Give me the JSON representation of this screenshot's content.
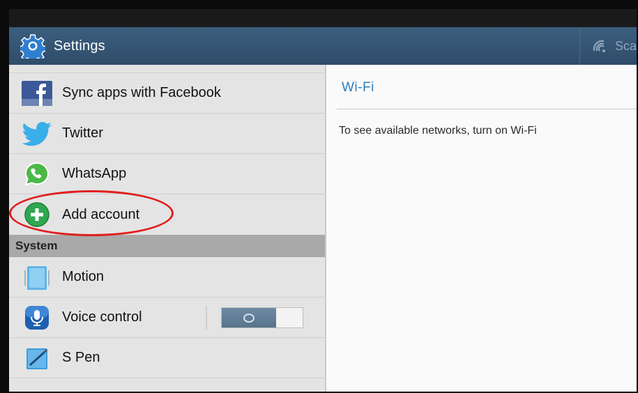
{
  "actionbar": {
    "title": "Settings",
    "scan_label": "Sca"
  },
  "accounts": [
    {
      "label": "Sync apps with Facebook",
      "icon": "facebook-icon"
    },
    {
      "label": "Twitter",
      "icon": "twitter-icon"
    },
    {
      "label": "WhatsApp",
      "icon": "whatsapp-icon"
    },
    {
      "label": "Add account",
      "icon": "add-icon"
    }
  ],
  "system": {
    "header": "System",
    "items": [
      {
        "label": "Motion",
        "icon": "motion-icon"
      },
      {
        "label": "Voice control",
        "icon": "microphone-icon",
        "toggle": "off"
      },
      {
        "label": "S Pen",
        "icon": "s-pen-icon"
      }
    ]
  },
  "detail": {
    "title": "Wi-Fi",
    "message": "To see available networks, turn on Wi-Fi"
  },
  "colors": {
    "actionbar": "#2e4d6a",
    "accent": "#2b7cbd",
    "highlight": "#e01e1e"
  }
}
